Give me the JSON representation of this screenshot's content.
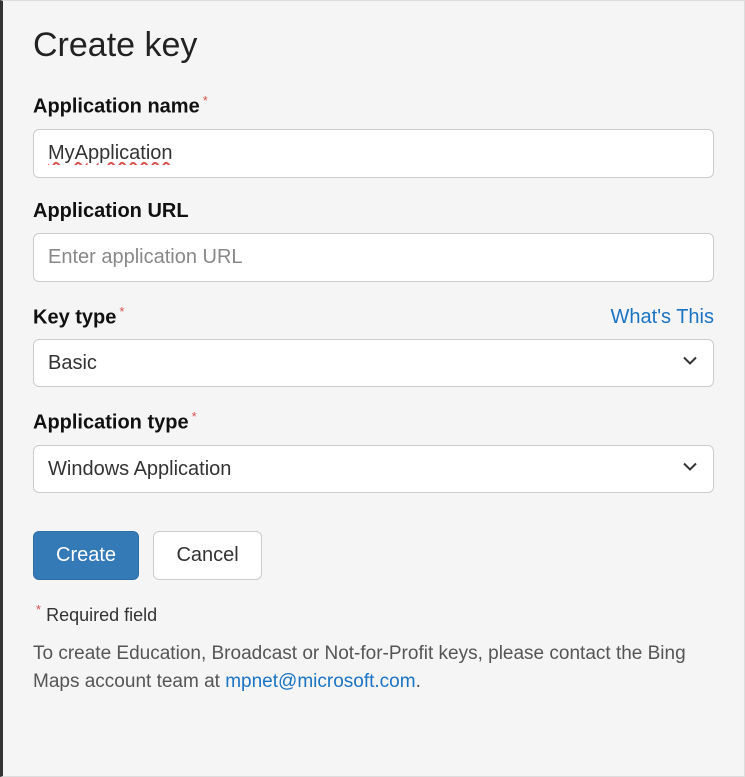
{
  "heading": "Create key",
  "fields": {
    "appName": {
      "label": "Application name",
      "value": "MyApplication",
      "required_marker": "*"
    },
    "appUrl": {
      "label": "Application URL",
      "placeholder": "Enter application URL"
    },
    "keyType": {
      "label": "Key type",
      "required_marker": "*",
      "help": "What's This",
      "selected": "Basic"
    },
    "appType": {
      "label": "Application type",
      "required_marker": "*",
      "selected": "Windows Application"
    }
  },
  "buttons": {
    "create": "Create",
    "cancel": "Cancel"
  },
  "requiredNote": {
    "marker": "*",
    "text": " Required field"
  },
  "info": {
    "prefix": "To create Education, Broadcast or Not-for-Profit keys, please contact the Bing Maps account team at ",
    "email": "mpnet@microsoft.com",
    "suffix": "."
  }
}
